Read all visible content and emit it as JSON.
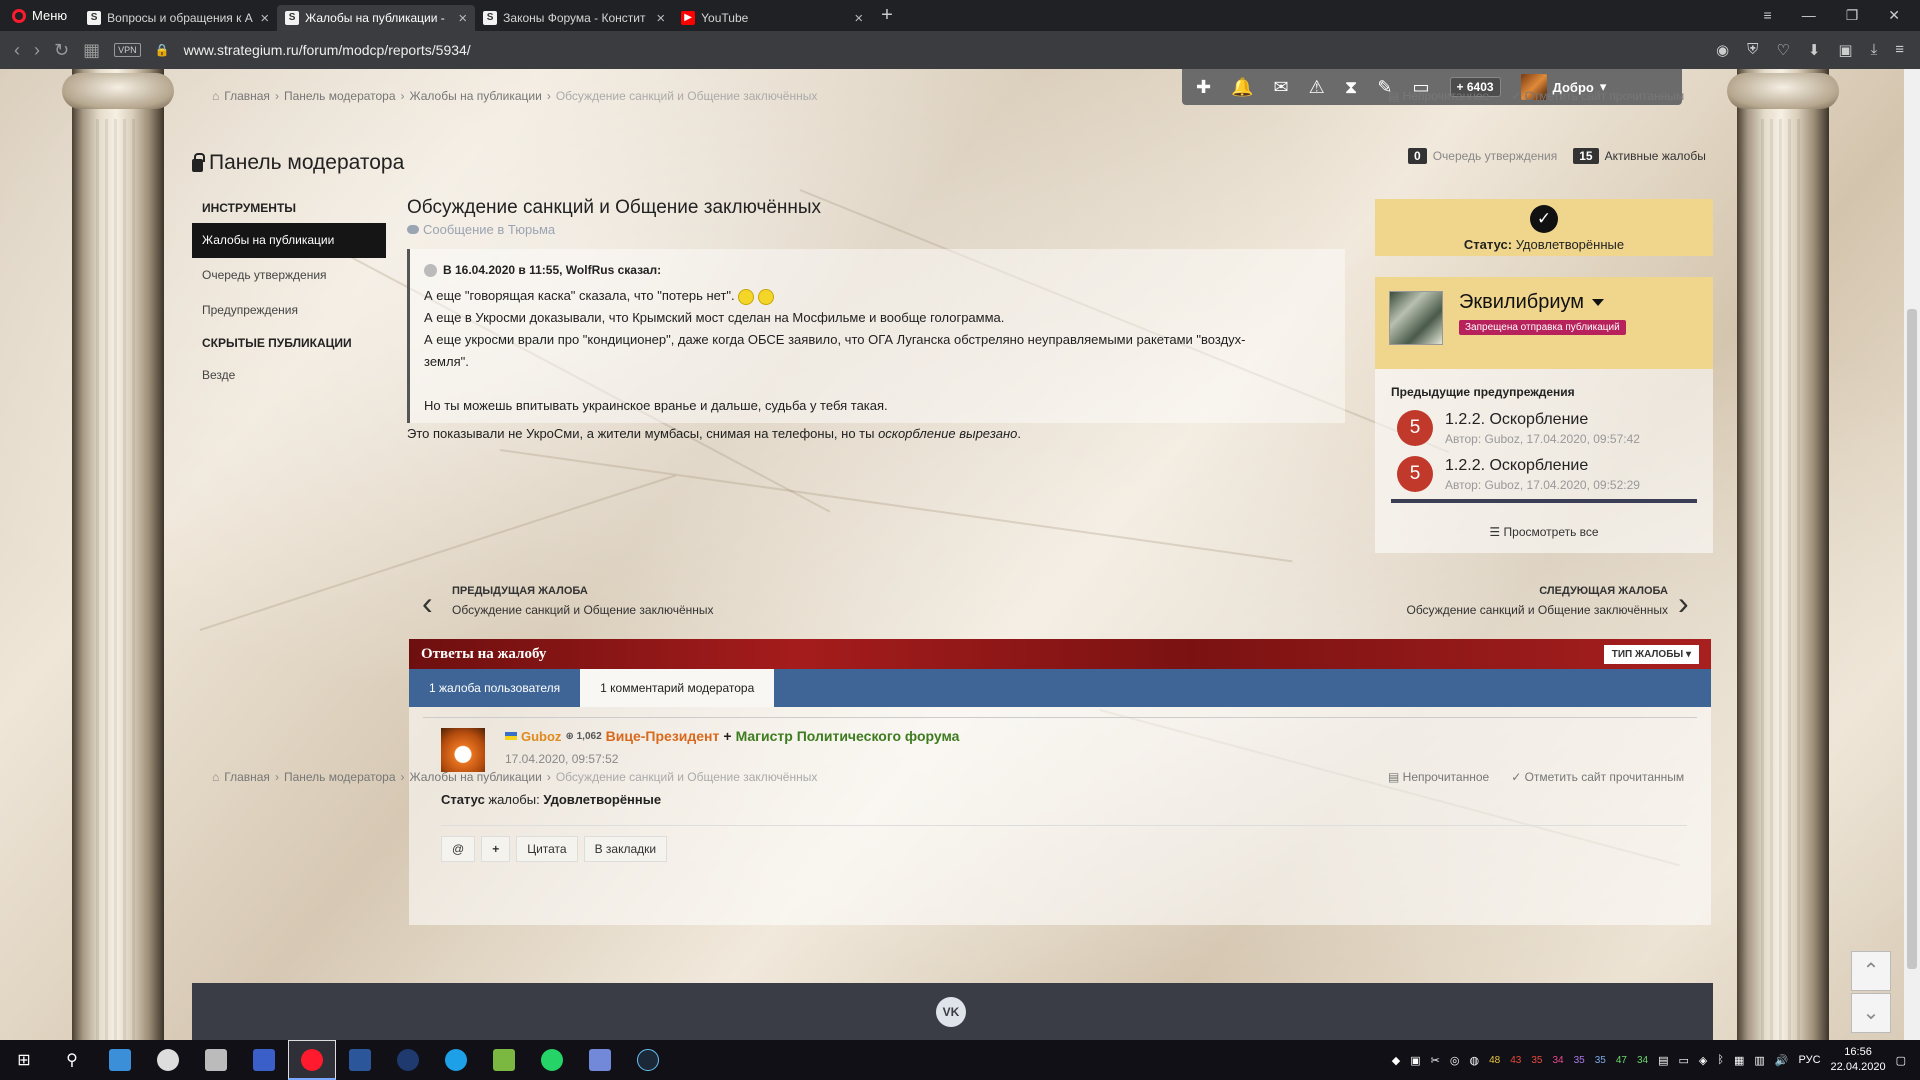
{
  "browser": {
    "menu_label": "Меню",
    "tabs": [
      {
        "title": "Вопросы и обращения к А",
        "icon": "S"
      },
      {
        "title": "Жалобы на публикации -",
        "icon": "S",
        "active": true
      },
      {
        "title": "Законы Форума - Констит",
        "icon": "S"
      },
      {
        "title": "YouTube",
        "icon": "yt"
      }
    ],
    "url": "www.strategium.ru/forum/modcp/reports/5934/",
    "vpn_label": "VPN"
  },
  "userbar": {
    "reputation": "6403",
    "greeting": "Добро"
  },
  "breadcrumb": {
    "items": [
      "Главная",
      "Панель модератора",
      "Жалобы на публикации"
    ],
    "current": "Обсуждение санкций и Общение заключённых",
    "unread": "Непрочитанное",
    "mark_read": "Отметить сайт прочитанным"
  },
  "page": {
    "title": "Панель модератора",
    "queue_count": "0",
    "queue_label": "Очередь утверждения",
    "active_count": "15",
    "active_label": "Активные жалобы"
  },
  "sidebar": {
    "tools_heading": "Инструменты",
    "items": [
      "Жалобы на публикации",
      "Очередь утверждения",
      "Предупреждения"
    ],
    "hidden_heading": "Скрытые публикации",
    "hidden_items": [
      "Везде"
    ]
  },
  "report": {
    "title": "Обсуждение санкций и Общение заключённых",
    "subtitle": "Сообщение в Тюрьма",
    "quote_head": "В 16.04.2020 в 11:55, WolfRus сказал:",
    "quote_lines": [
      "А еще \"говорящая каска\" сказала, что \"потерь нет\".",
      "А еще в Укросми доказывали, что Крымский мост сделан на Мосфильме и вообще голограмма.",
      "А еще укросми врали про \"кондиционер\", даже когда ОБСЕ заявило, что ОГА Луганска обстреляно неуправляемыми ракетами \"воздух-",
      "земля\".",
      "",
      "Но ты можешь впитывать украинское вранье и дальше, судьба у тебя такая."
    ],
    "reply_text": "Это показывали не УкроСми, а жители мумбасы, снимая на телефоны, но ты ",
    "reply_italic": "оскорбление вырезано",
    "reply_end": "."
  },
  "status": {
    "label": "Статус:",
    "value": "Удовлетворённые"
  },
  "reported_user": {
    "name": "Эквилибриум",
    "badge": "Запрещена отправка публикаций",
    "warnings_heading": "Предыдущие предупреждения",
    "warnings": [
      {
        "points": "5",
        "title": "1.2.2. Оскорбление",
        "meta": "Автор: Guboz, 17.04.2020, 09:57:42"
      },
      {
        "points": "5",
        "title": "1.2.2. Оскорбление",
        "meta": "Автор: Guboz, 17.04.2020, 09:52:29"
      }
    ],
    "view_all": "Просмотреть все"
  },
  "pagination": {
    "prev_label": "Предыдущая жалоба",
    "prev_title": "Обсуждение санкций и Общение заключённых",
    "next_label": "Следующая жалоба",
    "next_title": "Обсуждение санкций и Общение заключённых"
  },
  "replies": {
    "heading": "Ответы на жалобу",
    "type_button": "Тип жалобы",
    "tabs": [
      "1 жалоба пользователя",
      "1 комментарий модератора"
    ],
    "comment": {
      "author": "Guboz",
      "rep": "1,062",
      "role1": "Вице-Президент",
      "plus": "+",
      "role2": "Магистр Политического форума",
      "date": "17.04.2020, 09:57:52",
      "status_bold": "Статус",
      "status_mid": " жалобы: ",
      "status_value": "Удовлетворённые"
    },
    "actions": [
      "@",
      "+",
      "Цитата",
      "В закладки"
    ]
  },
  "footer": {
    "vk": "VK"
  },
  "taskbar": {
    "lang": "РУС",
    "time": "16:56",
    "date": "22.04.2020",
    "tray_nums": [
      "48",
      "43",
      "35",
      "34",
      "35",
      "35",
      "47",
      "34"
    ]
  }
}
